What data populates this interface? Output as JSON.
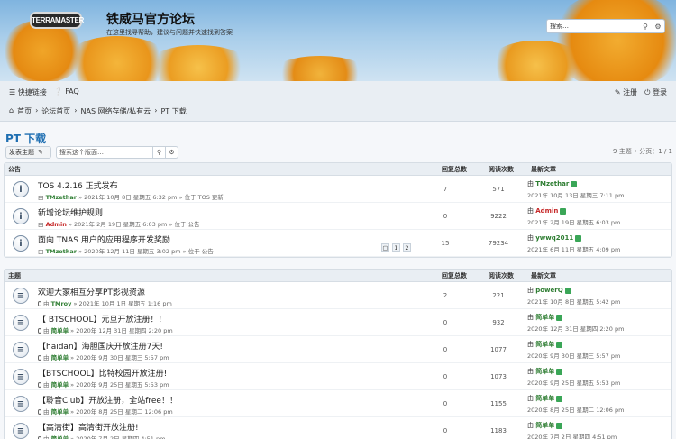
{
  "header": {
    "logo_text": "TERRAMASTER",
    "title": "铁威马官方论坛",
    "subtitle": "在这里找寻帮助，建议与问题并快速找到答案",
    "search_placeholder": "搜索…"
  },
  "navbar": {
    "quick_links": "快捷链接",
    "faq": "FAQ",
    "register": "注册",
    "login": "登录"
  },
  "breadcrumbs": [
    "首页",
    "论坛首页",
    "NAS 网络存储/私有云",
    "PT 下载"
  ],
  "page": {
    "title": "PT 下载",
    "new_topic": "发表主题",
    "forum_search_placeholder": "搜索这个版面…",
    "pagination": "9 主题 • 分页：1 / 1"
  },
  "announcements": {
    "header": {
      "col1": "公告",
      "col2": "回复总数",
      "col3": "阅读次数",
      "col4": "最新文章"
    },
    "rows": [
      {
        "title": "TOS 4.2.16 正式发布",
        "by": "由",
        "author": "TMzethar",
        "meta": "» 2021年 10月 8日 星期五 6:32 pm » 位于 TOS 更新",
        "replies": "7",
        "views": "571",
        "last_by": "由",
        "last_author": "TMzethar",
        "last_time": "2021年 10月 13日 星期三 7:11 pm"
      },
      {
        "title": "新增论坛维护规则",
        "by": "由",
        "author": "Admin",
        "meta": "» 2021年 2月 19日 星期五 6:03 pm » 位于 公告",
        "replies": "0",
        "views": "9222",
        "last_by": "由",
        "last_author": "Admin",
        "last_time": "2021年 2月 19日 星期五 6:03 pm"
      },
      {
        "title": "面向 TNAS 用户的应用程序开发奖励",
        "by": "由",
        "author": "TMzethar",
        "meta": "» 2020年 12月 11日 星期五 3:02 pm » 位于 公告",
        "replies": "15",
        "views": "79234",
        "last_by": "由",
        "last_author": "ywwq2011",
        "last_time": "2021年 6月 11日 星期五 4:09 pm",
        "pages": [
          "1",
          "2"
        ]
      }
    ]
  },
  "topics": {
    "header": {
      "col1": "主题",
      "col2": "回复总数",
      "col3": "阅读次数",
      "col4": "最新文章"
    },
    "rows": [
      {
        "title": "欢迎大家相互分享PT影视资源",
        "by": "由",
        "author": "TMroy",
        "meta": "» 2021年 10月 1日 星期五 1:16 pm",
        "replies": "2",
        "views": "221",
        "last_by": "由",
        "last_author": "powerQ",
        "last_time": "2021年 10月 8日 星期五 5:42 pm"
      },
      {
        "title": "【 BTSCHOOL】元旦开放注册！！",
        "by": "由",
        "author": "简单单",
        "meta": "» 2020年 12月 31日 星期四 2:20 pm",
        "replies": "0",
        "views": "932",
        "last_by": "由",
        "last_author": "简单单",
        "last_time": "2020年 12月 31日 星期四 2:20 pm"
      },
      {
        "title": "【haidan】海胆国庆开放注册7天!",
        "by": "由",
        "author": "简单单",
        "meta": "» 2020年 9月 30日 星期三 5:57 pm",
        "replies": "0",
        "views": "1077",
        "last_by": "由",
        "last_author": "简单单",
        "last_time": "2020年 9月 30日 星期三 5:57 pm"
      },
      {
        "title": "【BTSCHOOL】比特校园开放注册!",
        "by": "由",
        "author": "简单单",
        "meta": "» 2020年 9月 25日 星期五 5:53 pm",
        "replies": "0",
        "views": "1073",
        "last_by": "由",
        "last_author": "简单单",
        "last_time": "2020年 9月 25日 星期五 5:53 pm"
      },
      {
        "title": "【聆音Club】开放注册，全站free！！",
        "by": "由",
        "author": "简单单",
        "meta": "» 2020年 8月 25日 星期二 12:06 pm",
        "replies": "0",
        "views": "1155",
        "last_by": "由",
        "last_author": "简单单",
        "last_time": "2020年 8月 25日 星期二 12:06 pm"
      },
      {
        "title": "【高清街】高清街开放注册!",
        "by": "由",
        "author": "简单单",
        "meta": "» 2020年 7月 2日 星期四 4:51 pm",
        "replies": "0",
        "views": "1183",
        "last_by": "由",
        "last_author": "简单单",
        "last_time": "2020年 7月 2日 星期四 4:51 pm"
      }
    ]
  }
}
